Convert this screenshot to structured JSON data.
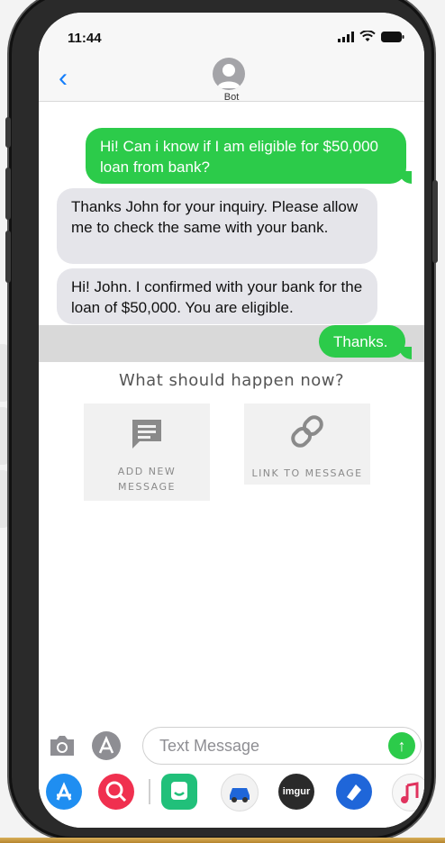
{
  "status": {
    "time": "11:44"
  },
  "header": {
    "contact_name": "Bot",
    "back_glyph": "‹"
  },
  "messages": [
    {
      "direction": "outgoing",
      "text": "Hi! Can i know if I am eligible for $50,000 loan from bank?"
    },
    {
      "direction": "incoming",
      "text": "Thanks John for your inquiry. Please allow me to check the same with your bank."
    },
    {
      "direction": "incoming",
      "text": "Hi! John. I confirmed with your bank for the loan of $50,000. You are eligible."
    },
    {
      "direction": "outgoing",
      "text": "Thanks."
    }
  ],
  "prompt": {
    "text": "What should happen now?"
  },
  "actions": [
    {
      "label_line1": "ADD NEW",
      "label_line2": "MESSAGE",
      "icon": "message-icon"
    },
    {
      "label_line1": "LINK TO MESSAGE",
      "icon": "link-icon"
    }
  ],
  "composer": {
    "placeholder": "Text Message",
    "send_glyph": "↑"
  },
  "apps": [
    {
      "name": "app-store-icon",
      "color": "#1f8ef1"
    },
    {
      "name": "search-globe-icon",
      "color": "#f0304f"
    },
    {
      "name": "smiley-app-icon",
      "color": "#21c07a"
    },
    {
      "name": "car-app-icon",
      "color": "#f2f2f2"
    },
    {
      "name": "imgur-icon",
      "color": "#2a2a2a",
      "label": "imgur"
    },
    {
      "name": "shazam-icon",
      "color": "#1f66d9"
    },
    {
      "name": "music-icon",
      "color": "#f7f7f7"
    }
  ],
  "colors": {
    "outgoing_bubble": "#2ccb4a",
    "incoming_bubble": "#e5e5ea",
    "accent": "#147efb"
  }
}
